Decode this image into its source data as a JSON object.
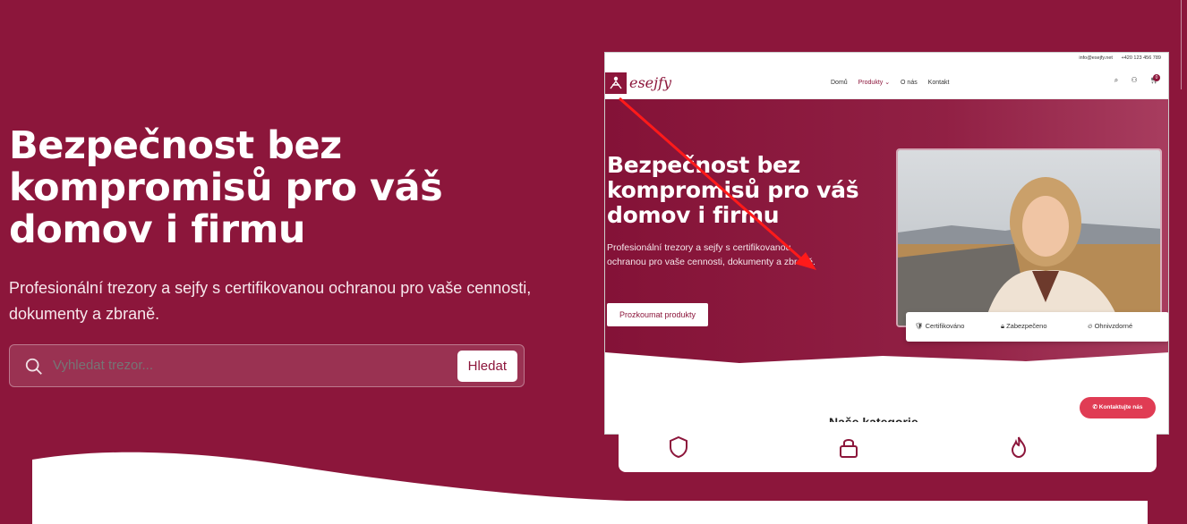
{
  "hero": {
    "title": "Bezpečnost bez kompromisů pro váš domov i firmu",
    "subtitle": "Profesionální trezory a sejfy s certifikovanou ochranou pro vaše cennosti, dokumenty a zbraně.",
    "search_placeholder": "Vyhledat trezor...",
    "search_button": "Hledat"
  },
  "preview": {
    "topbar_email": "info@esejfy.net",
    "topbar_phone": "+420 123 456 789",
    "logo_text": "esejfy",
    "nav": [
      "Domů",
      "Produkty",
      "O nás",
      "Kontakt"
    ],
    "cart_count": "0",
    "title": "Bezpečnost bez kompromisů pro váš domov i firmu",
    "subtitle": "Profesionální trezory a sejfy s certifikovanou ochranou pro vaše cennosti, dokumenty a zbraně.",
    "cta": "Prozkoumat produkty",
    "badges": [
      "Certifikováno",
      "Zabezpečeno",
      "Ohnivzdorné"
    ],
    "contact_button": "Kontaktujte nás",
    "section_heading_partial": "Naše kategorie"
  },
  "bottom_card_icons": [
    "shield-icon",
    "lock-icon",
    "flame-icon"
  ],
  "colors": {
    "brand": "#8c163b",
    "accent": "#e03c54",
    "annotation_arrow": "#ff0000"
  }
}
